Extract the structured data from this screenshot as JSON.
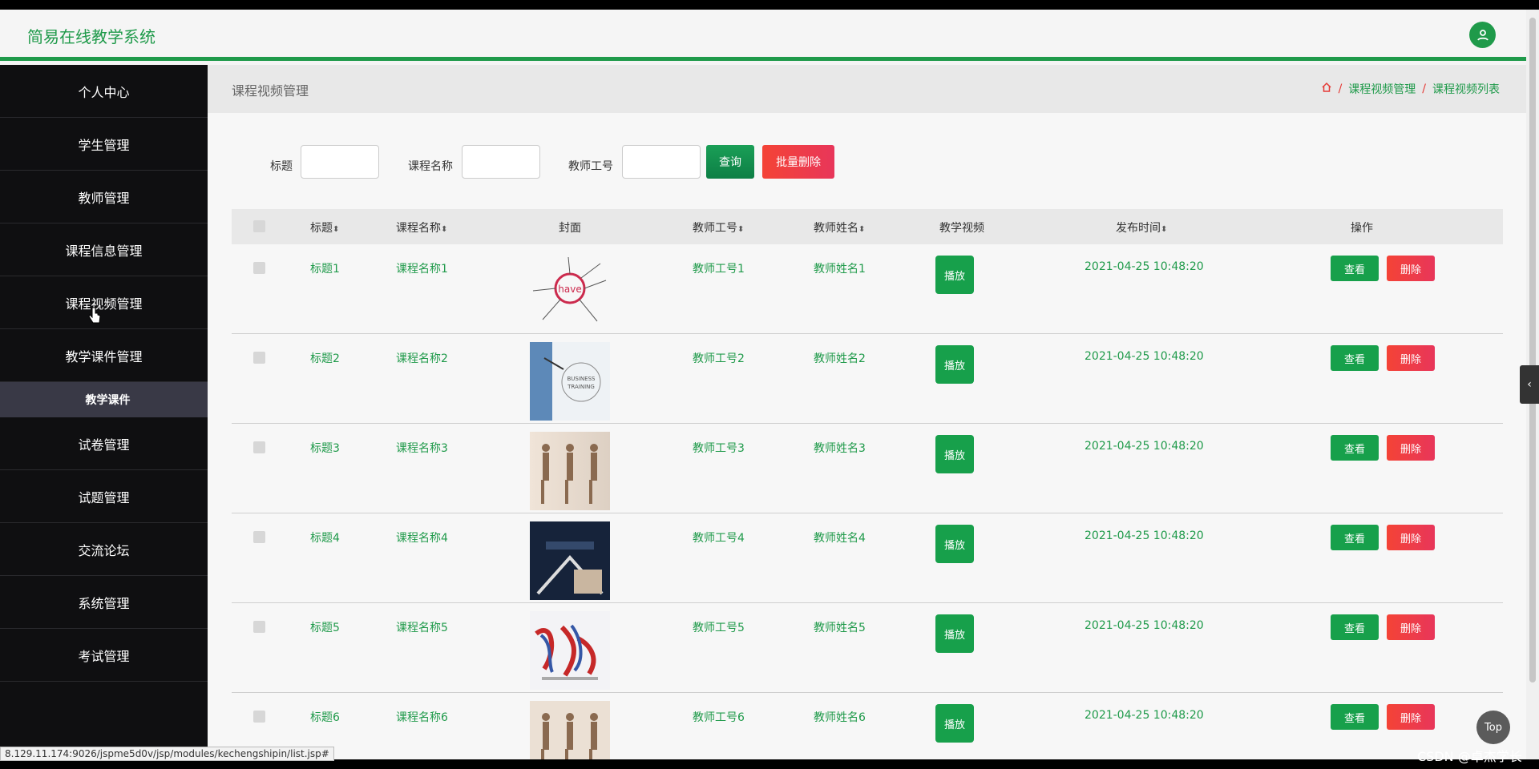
{
  "app": {
    "title": "简易在线教学系统"
  },
  "sidebar": {
    "items": [
      {
        "label": "个人中心"
      },
      {
        "label": "学生管理"
      },
      {
        "label": "教师管理"
      },
      {
        "label": "课程信息管理"
      },
      {
        "label": "课程视频管理"
      },
      {
        "label": "教学课件管理"
      },
      {
        "label": "教学课件",
        "submenu": true
      },
      {
        "label": "试卷管理"
      },
      {
        "label": "试题管理"
      },
      {
        "label": "交流论坛"
      },
      {
        "label": "系统管理"
      },
      {
        "label": "考试管理"
      }
    ]
  },
  "main": {
    "page_title": "课程视频管理",
    "breadcrumb": [
      "课程视频管理",
      "课程视频列表"
    ],
    "search": {
      "title_label": "标题",
      "course_label": "课程名称",
      "teacher_label": "教师工号",
      "query_button": "查询",
      "batch_delete_button": "批量删除"
    },
    "table": {
      "headers": [
        "标题",
        "课程名称",
        "封面",
        "教师工号",
        "教师姓名",
        "教学视频",
        "发布时间",
        "操作"
      ],
      "rows": [
        {
          "title": "标题1",
          "course": "课程名称1",
          "teacher_no": "教师工号1",
          "teacher_name": "教师姓名1",
          "time": "2021-04-25 10:48:20"
        },
        {
          "title": "标题2",
          "course": "课程名称2",
          "teacher_no": "教师工号2",
          "teacher_name": "教师姓名2",
          "time": "2021-04-25 10:48:20"
        },
        {
          "title": "标题3",
          "course": "课程名称3",
          "teacher_no": "教师工号3",
          "teacher_name": "教师姓名3",
          "time": "2021-04-25 10:48:20"
        },
        {
          "title": "标题4",
          "course": "课程名称4",
          "teacher_no": "教师工号4",
          "teacher_name": "教师姓名4",
          "time": "2021-04-25 10:48:20"
        },
        {
          "title": "标题5",
          "course": "课程名称5",
          "teacher_no": "教师工号5",
          "teacher_name": "教师姓名5",
          "time": "2021-04-25 10:48:20"
        },
        {
          "title": "标题6",
          "course": "课程名称6",
          "teacher_no": "教师工号6",
          "teacher_name": "教师姓名6",
          "time": "2021-04-25 10:48:20"
        }
      ],
      "play_button": "播放",
      "view_button": "查看",
      "delete_button": "删除"
    }
  },
  "status": {
    "url": "8.129.11.174:9026/jspme5d0v/jsp/modules/kechengshipin/list.jsp#"
  },
  "overlay": {
    "top_button": "Top",
    "watermark": "CSDN @卓杰学长"
  },
  "colors": {
    "accent": "#1f9a4a",
    "danger": "#f44336",
    "sidebar": "#0f0f11"
  },
  "icons": {
    "avatar": "user-icon",
    "home": "home-icon",
    "collapse": "chevron-left-icon"
  }
}
